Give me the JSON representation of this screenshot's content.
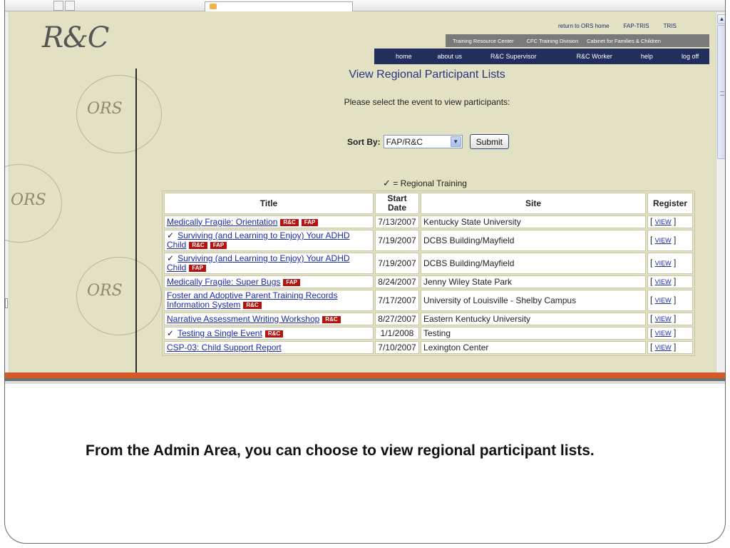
{
  "logo": "R&C",
  "watermark": "ORS",
  "nav": {
    "top": [
      "return to ORS home",
      "FAP-TRIS",
      "TRIS"
    ],
    "middle": [
      "Training Resource Center",
      "CFC Training Division",
      "Cabinet for Families & Children"
    ],
    "main": [
      "home",
      "about us",
      "R&C Supervisor",
      "R&C Worker",
      "help",
      "log off"
    ]
  },
  "page": {
    "title": "View Regional Participant Lists",
    "subtitle": "Please select the event to view participants:",
    "sort_label": "Sort By:",
    "sort_value": "FAP/R&C",
    "submit_label": "Submit",
    "legend": "= Regional Training"
  },
  "table": {
    "headers": [
      "Title",
      "Start Date",
      "Site",
      "Register"
    ],
    "rows": [
      {
        "check": "",
        "title": "Medically Fragile: Orientation",
        "badges": [
          "R&C",
          "FAP"
        ],
        "date": "7/13/2007",
        "site": "Kentucky State University",
        "register": "VIEW"
      },
      {
        "check": "✓",
        "title": "Surviving (and Learning to Enjoy) Your ADHD Child",
        "badges": [
          "R&C",
          "FAP"
        ],
        "date": "7/19/2007",
        "site": "DCBS Building/Mayfield",
        "register": "VIEW"
      },
      {
        "check": "✓",
        "title": "Surviving (and Learning to Enjoy) Your ADHD Child",
        "badges": [
          "FAP"
        ],
        "date": "7/19/2007",
        "site": "DCBS Building/Mayfield",
        "register": "VIEW"
      },
      {
        "check": "",
        "title": "Medically Fragile: Super Bugs",
        "badges": [
          "FAP"
        ],
        "date": "8/24/2007",
        "site": "Jenny Wiley State Park",
        "register": "VIEW"
      },
      {
        "check": "",
        "title": "Foster and Adoptive Parent Training Records Information System",
        "badges": [
          "R&C"
        ],
        "date": "7/17/2007",
        "site": "University of Louisville - Shelby Campus",
        "register": "VIEW"
      },
      {
        "check": "",
        "title": "Narrative Assessment Writing Workshop",
        "badges": [
          "R&C"
        ],
        "date": "8/27/2007",
        "site": "Eastern Kentucky University",
        "register": "VIEW"
      },
      {
        "check": "✓",
        "title": "Testing a Single Event",
        "badges": [
          "R&C"
        ],
        "date": "1/1/2008",
        "site": "Testing",
        "register": "VIEW"
      },
      {
        "check": "",
        "title": "CSP-03: Child Support Report",
        "badges": [],
        "date": "7/10/2007",
        "site": "Lexington Center",
        "register": "VIEW"
      }
    ]
  },
  "caption": "From the Admin Area, you can choose to view regional participant lists."
}
